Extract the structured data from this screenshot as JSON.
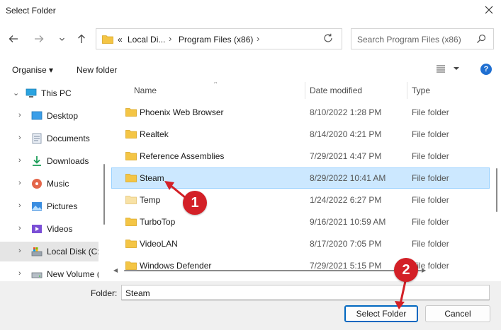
{
  "window": {
    "title": "Select Folder"
  },
  "address": {
    "crumbs": [
      "«",
      "Local Di...",
      "Program Files (x86)"
    ]
  },
  "search": {
    "placeholder": "Search Program Files (x86)"
  },
  "toolbar": {
    "organise": "Organise ▾",
    "new_folder": "New folder",
    "help": "?"
  },
  "navpane": {
    "items": [
      {
        "label": "This PC",
        "icon": "pc-icon",
        "expanded": true
      },
      {
        "label": "Desktop",
        "icon": "desktop-icon"
      },
      {
        "label": "Documents",
        "icon": "documents-icon"
      },
      {
        "label": "Downloads",
        "icon": "downloads-icon"
      },
      {
        "label": "Music",
        "icon": "music-icon"
      },
      {
        "label": "Pictures",
        "icon": "pictures-icon"
      },
      {
        "label": "Videos",
        "icon": "videos-icon"
      },
      {
        "label": "Local Disk (C:",
        "icon": "disk-icon",
        "selected": true
      },
      {
        "label": "New Volume (",
        "icon": "disk-icon"
      }
    ]
  },
  "columns": {
    "name": "Name",
    "date": "Date modified",
    "type": "Type"
  },
  "files": [
    {
      "name": "Phoenix Web Browser",
      "date": "8/10/2022 1:28 PM",
      "type": "File folder"
    },
    {
      "name": "Realtek",
      "date": "8/14/2020 4:21 PM",
      "type": "File folder"
    },
    {
      "name": "Reference Assemblies",
      "date": "7/29/2021 4:47 PM",
      "type": "File folder"
    },
    {
      "name": "Steam",
      "date": "8/29/2022 10:41 AM",
      "type": "File folder",
      "selected": true
    },
    {
      "name": "Temp",
      "date": "1/24/2022 6:27 PM",
      "type": "File folder",
      "light": true
    },
    {
      "name": "TurboTop",
      "date": "9/16/2021 10:59 AM",
      "type": "File folder"
    },
    {
      "name": "VideoLAN",
      "date": "8/17/2020 7:05 PM",
      "type": "File folder"
    },
    {
      "name": "Windows Defender",
      "date": "7/29/2021 5:15 PM",
      "type": "File folder"
    }
  ],
  "folder_field": {
    "label": "Folder:",
    "value": "Steam"
  },
  "buttons": {
    "select": "Select Folder",
    "cancel": "Cancel"
  },
  "annotations": {
    "badge1": "1",
    "badge2": "2"
  },
  "colors": {
    "accent": "#0067c0",
    "selection": "#cce8ff",
    "badge": "#d32027",
    "folder": "#f4c545"
  }
}
